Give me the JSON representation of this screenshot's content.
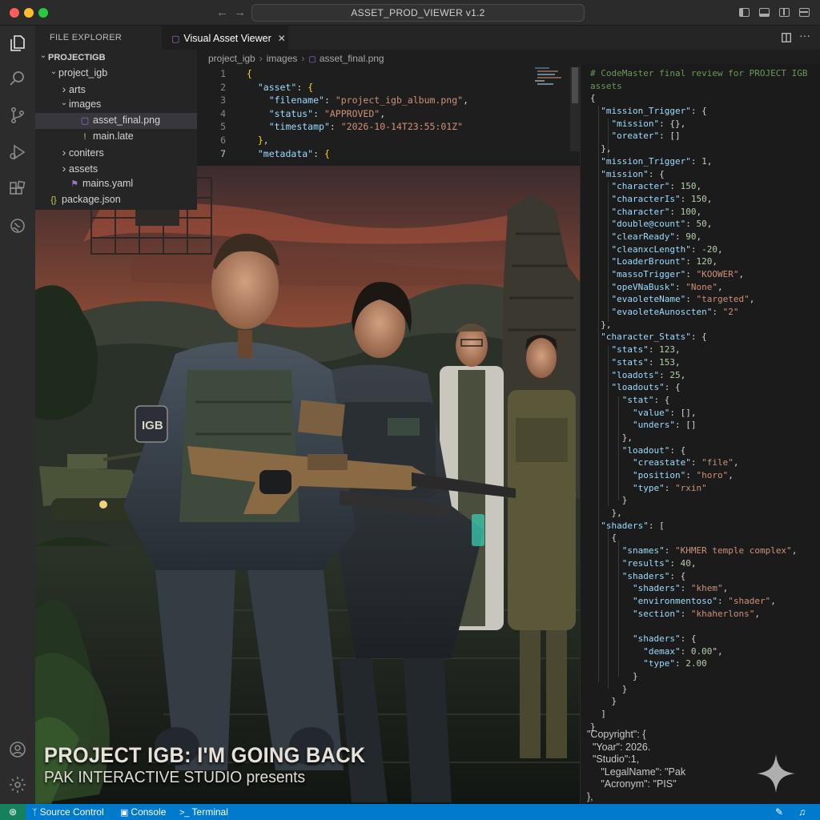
{
  "window": {
    "title": "ASSET_PROD_VIEWER v1.2"
  },
  "sidebar": {
    "header": "FILE EXPLORER",
    "tree": [
      {
        "label": "PROJECTIGB",
        "depth": 0,
        "chevron": "down",
        "icon": "",
        "bold": true
      },
      {
        "label": "project_igb",
        "depth": 1,
        "chevron": "down",
        "icon": ""
      },
      {
        "label": "arts",
        "depth": 2,
        "chevron": "right",
        "icon": ""
      },
      {
        "label": "images",
        "depth": 2,
        "chevron": "down",
        "icon": ""
      },
      {
        "label": "asset_final.png",
        "depth": 3,
        "chevron": "",
        "icon": "image-file-icon",
        "selected": true
      },
      {
        "label": "main.late",
        "depth": 3,
        "chevron": "",
        "icon": "exclaim-file-icon"
      },
      {
        "label": "coniters",
        "depth": 2,
        "chevron": "right",
        "icon": ""
      },
      {
        "label": "assets",
        "depth": 2,
        "chevron": "right",
        "icon": ""
      },
      {
        "label": "mains.yaml",
        "depth": 2,
        "chevron": "",
        "icon": "yaml-file-icon"
      },
      {
        "label": "package.json",
        "depth": 0,
        "chevron": "",
        "icon": "json-file-icon"
      }
    ]
  },
  "editor": {
    "tab_label": "Visual Asset Viewer",
    "breadcrumb": [
      "project_igb",
      "images",
      "asset_final.png"
    ],
    "lines": [
      {
        "num": "1",
        "text": "{"
      },
      {
        "num": "2",
        "text": "  \"asset\": {"
      },
      {
        "num": "3",
        "text": "    \"filename\": \"project_igb_album.png\","
      },
      {
        "num": "4",
        "text": "    \"status\": \"APPROVED\","
      },
      {
        "num": "5",
        "text": "    \"timestamp\": \"2026-10-14T23:55:01Z\""
      },
      {
        "num": "6",
        "text": "  },"
      },
      {
        "num": "7",
        "text": "  \"metadata\": {"
      }
    ]
  },
  "review_panel": {
    "lines": [
      "# CodeMaster final review for PROJECT IGB",
      "assets",
      "{",
      "  \"mission_Trigger\": {",
      "    \"mission\": {},",
      "    \"oreater\": []",
      "  },",
      "  \"mission_Trigger\": 1,",
      "  \"mission\": {",
      "    \"character\": 150,",
      "    \"characterIs\": 150,",
      "    \"character\": 100,",
      "    \"double@count\": 50,",
      "    \"clearReady\": 90,",
      "    \"cleanxcLength\": -20,",
      "    \"LoaderBrount\": 120,",
      "    \"massoTrigger\": \"KOOWER\",",
      "    \"opeVNaBusk\": \"None\",",
      "    \"evaoleteName\": \"targeted\",",
      "    \"evaoleteAunoscten\": \"2\"",
      "  },",
      "  \"character_Stats\": {",
      "    \"stats\": 123,",
      "    \"stats\": 153,",
      "    \"loadots\": 25,",
      "    \"loadouts\": {",
      "      \"stat\": {",
      "        \"value\": [],",
      "        \"unders\": []",
      "      },",
      "      \"loadout\": {",
      "        \"creastate\": \"file\",",
      "        \"position\": \"horo\",",
      "        \"type\": \"rxin\"",
      "      }",
      "    },",
      "  \"shaders\": [",
      "    {",
      "      \"snames\": \"KHMER temple complex\",",
      "      \"results\": 40,",
      "      \"shaders\": {",
      "        \"shaders\": \"khem\",",
      "        \"environmentoso\": \"shader\",",
      "        \"section\": \"khaherlons\",",
      "",
      "        \"shaders\": {",
      "          \"demax\": 0.00\",",
      "          \"type\": 2.00",
      "        }",
      "      }",
      "    }",
      "  ]",
      "}"
    ],
    "copyright": [
      "\"Copyright\": {",
      "  \"Yoar\": 2026.",
      "  \"Studio\":1,",
      "     \"LegalName\": \"Pak",
      "     \"Acronym\": \"PIS\"",
      "},"
    ]
  },
  "poster": {
    "title": "PROJECT IGB: I'M GOING BACK",
    "subtitle": "PAK INTERACTIVE STUDIO presents",
    "patch_label": "IGB"
  },
  "statusbar": {
    "items": [
      "Source Control",
      "Console",
      "Terminal"
    ]
  }
}
